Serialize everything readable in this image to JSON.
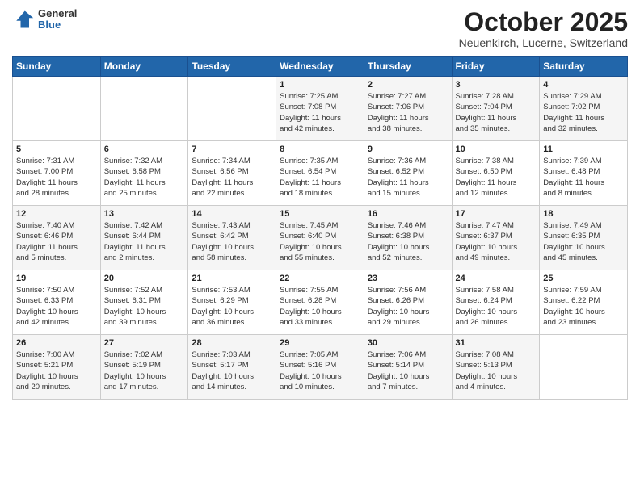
{
  "header": {
    "logo_general": "General",
    "logo_blue": "Blue",
    "month_title": "October 2025",
    "location": "Neuenkirch, Lucerne, Switzerland"
  },
  "weekdays": [
    "Sunday",
    "Monday",
    "Tuesday",
    "Wednesday",
    "Thursday",
    "Friday",
    "Saturday"
  ],
  "weeks": [
    [
      {
        "day": "",
        "info": ""
      },
      {
        "day": "",
        "info": ""
      },
      {
        "day": "",
        "info": ""
      },
      {
        "day": "1",
        "info": "Sunrise: 7:25 AM\nSunset: 7:08 PM\nDaylight: 11 hours\nand 42 minutes."
      },
      {
        "day": "2",
        "info": "Sunrise: 7:27 AM\nSunset: 7:06 PM\nDaylight: 11 hours\nand 38 minutes."
      },
      {
        "day": "3",
        "info": "Sunrise: 7:28 AM\nSunset: 7:04 PM\nDaylight: 11 hours\nand 35 minutes."
      },
      {
        "day": "4",
        "info": "Sunrise: 7:29 AM\nSunset: 7:02 PM\nDaylight: 11 hours\nand 32 minutes."
      }
    ],
    [
      {
        "day": "5",
        "info": "Sunrise: 7:31 AM\nSunset: 7:00 PM\nDaylight: 11 hours\nand 28 minutes."
      },
      {
        "day": "6",
        "info": "Sunrise: 7:32 AM\nSunset: 6:58 PM\nDaylight: 11 hours\nand 25 minutes."
      },
      {
        "day": "7",
        "info": "Sunrise: 7:34 AM\nSunset: 6:56 PM\nDaylight: 11 hours\nand 22 minutes."
      },
      {
        "day": "8",
        "info": "Sunrise: 7:35 AM\nSunset: 6:54 PM\nDaylight: 11 hours\nand 18 minutes."
      },
      {
        "day": "9",
        "info": "Sunrise: 7:36 AM\nSunset: 6:52 PM\nDaylight: 11 hours\nand 15 minutes."
      },
      {
        "day": "10",
        "info": "Sunrise: 7:38 AM\nSunset: 6:50 PM\nDaylight: 11 hours\nand 12 minutes."
      },
      {
        "day": "11",
        "info": "Sunrise: 7:39 AM\nSunset: 6:48 PM\nDaylight: 11 hours\nand 8 minutes."
      }
    ],
    [
      {
        "day": "12",
        "info": "Sunrise: 7:40 AM\nSunset: 6:46 PM\nDaylight: 11 hours\nand 5 minutes."
      },
      {
        "day": "13",
        "info": "Sunrise: 7:42 AM\nSunset: 6:44 PM\nDaylight: 11 hours\nand 2 minutes."
      },
      {
        "day": "14",
        "info": "Sunrise: 7:43 AM\nSunset: 6:42 PM\nDaylight: 10 hours\nand 58 minutes."
      },
      {
        "day": "15",
        "info": "Sunrise: 7:45 AM\nSunset: 6:40 PM\nDaylight: 10 hours\nand 55 minutes."
      },
      {
        "day": "16",
        "info": "Sunrise: 7:46 AM\nSunset: 6:38 PM\nDaylight: 10 hours\nand 52 minutes."
      },
      {
        "day": "17",
        "info": "Sunrise: 7:47 AM\nSunset: 6:37 PM\nDaylight: 10 hours\nand 49 minutes."
      },
      {
        "day": "18",
        "info": "Sunrise: 7:49 AM\nSunset: 6:35 PM\nDaylight: 10 hours\nand 45 minutes."
      }
    ],
    [
      {
        "day": "19",
        "info": "Sunrise: 7:50 AM\nSunset: 6:33 PM\nDaylight: 10 hours\nand 42 minutes."
      },
      {
        "day": "20",
        "info": "Sunrise: 7:52 AM\nSunset: 6:31 PM\nDaylight: 10 hours\nand 39 minutes."
      },
      {
        "day": "21",
        "info": "Sunrise: 7:53 AM\nSunset: 6:29 PM\nDaylight: 10 hours\nand 36 minutes."
      },
      {
        "day": "22",
        "info": "Sunrise: 7:55 AM\nSunset: 6:28 PM\nDaylight: 10 hours\nand 33 minutes."
      },
      {
        "day": "23",
        "info": "Sunrise: 7:56 AM\nSunset: 6:26 PM\nDaylight: 10 hours\nand 29 minutes."
      },
      {
        "day": "24",
        "info": "Sunrise: 7:58 AM\nSunset: 6:24 PM\nDaylight: 10 hours\nand 26 minutes."
      },
      {
        "day": "25",
        "info": "Sunrise: 7:59 AM\nSunset: 6:22 PM\nDaylight: 10 hours\nand 23 minutes."
      }
    ],
    [
      {
        "day": "26",
        "info": "Sunrise: 7:00 AM\nSunset: 5:21 PM\nDaylight: 10 hours\nand 20 minutes."
      },
      {
        "day": "27",
        "info": "Sunrise: 7:02 AM\nSunset: 5:19 PM\nDaylight: 10 hours\nand 17 minutes."
      },
      {
        "day": "28",
        "info": "Sunrise: 7:03 AM\nSunset: 5:17 PM\nDaylight: 10 hours\nand 14 minutes."
      },
      {
        "day": "29",
        "info": "Sunrise: 7:05 AM\nSunset: 5:16 PM\nDaylight: 10 hours\nand 10 minutes."
      },
      {
        "day": "30",
        "info": "Sunrise: 7:06 AM\nSunset: 5:14 PM\nDaylight: 10 hours\nand 7 minutes."
      },
      {
        "day": "31",
        "info": "Sunrise: 7:08 AM\nSunset: 5:13 PM\nDaylight: 10 hours\nand 4 minutes."
      },
      {
        "day": "",
        "info": ""
      }
    ]
  ]
}
